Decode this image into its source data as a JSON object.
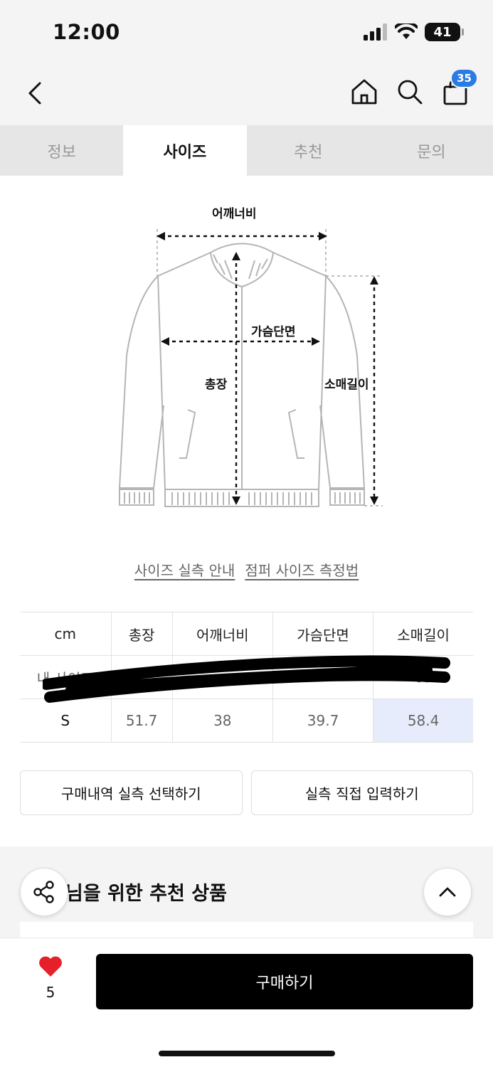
{
  "status": {
    "time": "12:00",
    "battery": "41"
  },
  "header": {
    "cart_badge": "35"
  },
  "tabs": [
    {
      "label": "정보"
    },
    {
      "label": "사이즈"
    },
    {
      "label": "추천"
    },
    {
      "label": "문의"
    }
  ],
  "diagram": {
    "shoulder": "어깨너비",
    "chest": "가슴단면",
    "length": "총장",
    "sleeve": "소매길이"
  },
  "links": {
    "size_guide": "사이즈 실측 안내",
    "measure_method": "점퍼 사이즈 측정법"
  },
  "size_table": {
    "headers": [
      "cm",
      "총장",
      "어깨너비",
      "가슴단면",
      "소매길이"
    ],
    "my_size": {
      "label": "내 사이즈",
      "sleeve": "63"
    },
    "rows": [
      {
        "size": "S",
        "values": [
          "51.7",
          "38",
          "39.7",
          "58.4"
        ]
      }
    ]
  },
  "buttons": {
    "purchase_history": "구매내역 실측 선택하기",
    "direct_input": "실측 직접 입력하기"
  },
  "recommend": {
    "title_partial": "님을 위한 추천 상품"
  },
  "bottom_bar": {
    "like_count": "5",
    "buy_label": "구매하기"
  },
  "colors": {
    "accent_badge": "#2a7be4",
    "highlight_cell": "#e6ecfb",
    "like_heart": "#e5202a"
  }
}
